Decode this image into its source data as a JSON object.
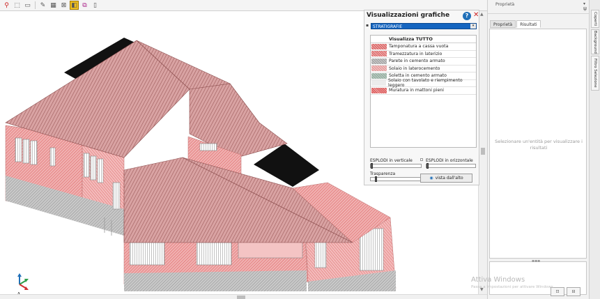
{
  "toolbar": {
    "icons": [
      "pin-icon",
      "select-icon",
      "layer-icon",
      "pencil-icon",
      "grid-icon",
      "cut-icon",
      "view-3d-icon",
      "export-icon",
      "copy-icon"
    ]
  },
  "graphics_panel": {
    "title": "Visualizzazioni grafiche",
    "help_label": "?",
    "close_label": "✕",
    "dropdown_value": "STRATIGRAFIE",
    "legend_header": "Visualizza TUTTO",
    "legend_items": [
      {
        "label": "Tamponatura a cassa vuota",
        "swatch": "hatch-red"
      },
      {
        "label": "Tramezzatura in laterizio",
        "swatch": "hatch-red-b"
      },
      {
        "label": "Parete in cemento armato",
        "swatch": "hatch-grey"
      },
      {
        "label": "Solaio in laterocemento",
        "swatch": "hatch-pink"
      },
      {
        "label": "Soletta in cemento armato",
        "swatch": "hatch-green"
      },
      {
        "label": "Solaio con tavolato e riempimento leggero",
        "swatch": "hatch-light"
      },
      {
        "label": "Muratura in mattoni pieni",
        "swatch": "hatch-brick"
      }
    ],
    "explode_vertical_label": "ESPLODI in verticale",
    "explode_horizontal_label": "ESPLODI in orizzontale",
    "transparency_label": "Trasparenza",
    "top_view_label": "vista dall'alto",
    "explode_vertical_value": 0,
    "explode_horizontal_value": 0,
    "transparency_value": 0.1
  },
  "properties_panel": {
    "title": "Proprietà",
    "pin": "▾ ⊟",
    "tabs": [
      {
        "label": "Proprietà",
        "active": false
      },
      {
        "label": "Risultati",
        "active": true
      }
    ],
    "empty_message": "Selezionare un'entità per visualizzare i risultati"
  },
  "side_tabs": {
    "items": [
      "Coperti",
      "Background",
      "Filtro Selezione"
    ]
  },
  "watermark": {
    "title": "Attiva Windows",
    "subtitle": "Passa a Impostazioni per attivare Windows."
  }
}
